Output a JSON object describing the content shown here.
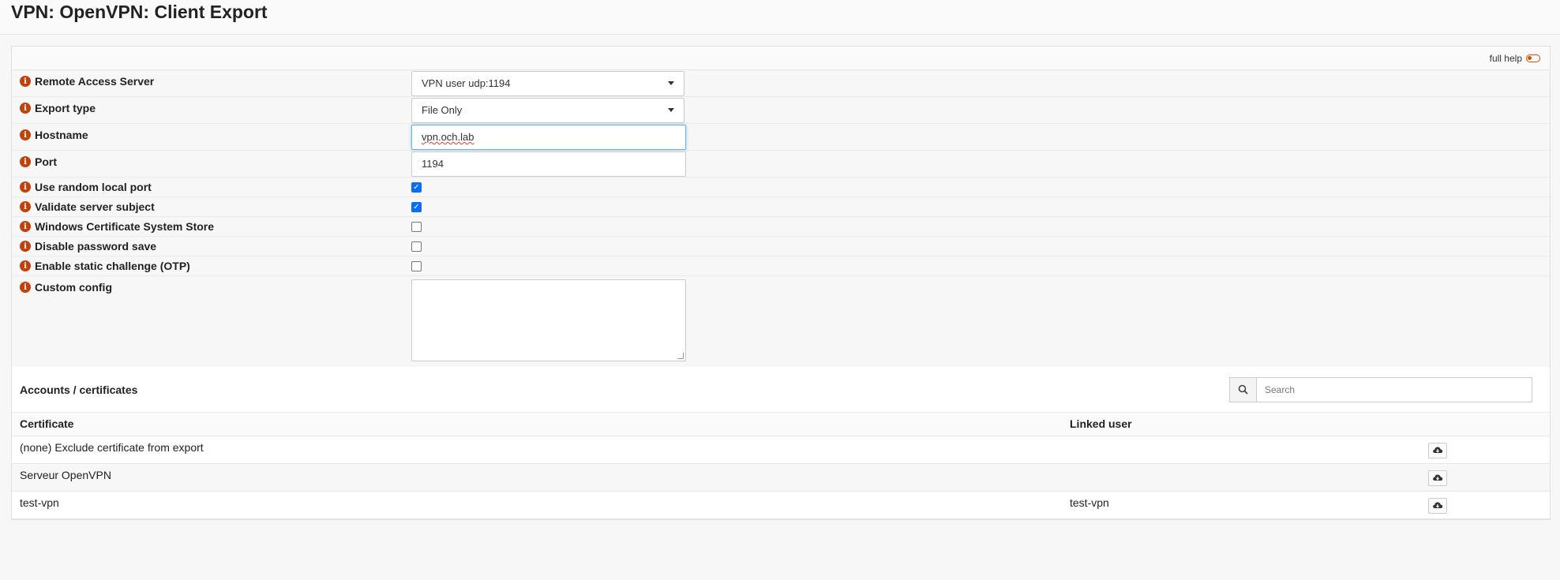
{
  "page": {
    "title": "VPN: OpenVPN: Client Export"
  },
  "help": {
    "label": "full help"
  },
  "form": {
    "remote_access_server": {
      "label": "Remote Access Server",
      "value": "VPN user udp:1194"
    },
    "export_type": {
      "label": "Export type",
      "value": "File Only"
    },
    "hostname": {
      "label": "Hostname",
      "value": "vpn.och.lab"
    },
    "port": {
      "label": "Port",
      "value": "1194"
    },
    "use_random_local_port": {
      "label": "Use random local port",
      "checked": true
    },
    "validate_server_subject": {
      "label": "Validate server subject",
      "checked": true
    },
    "windows_cert_store": {
      "label": "Windows Certificate System Store",
      "checked": false
    },
    "disable_password_save": {
      "label": "Disable password save",
      "checked": false
    },
    "static_challenge": {
      "label": "Enable static challenge (OTP)",
      "checked": false
    },
    "custom_config": {
      "label": "Custom config",
      "value": ""
    }
  },
  "accounts": {
    "title": "Accounts / certificates",
    "search_placeholder": "Search",
    "columns": [
      "Certificate",
      "Linked user"
    ],
    "rows": [
      {
        "certificate": "(none) Exclude certificate from export",
        "linked_user": ""
      },
      {
        "certificate": "Serveur OpenVPN",
        "linked_user": ""
      },
      {
        "certificate": "test-vpn",
        "linked_user": "test-vpn"
      }
    ]
  }
}
